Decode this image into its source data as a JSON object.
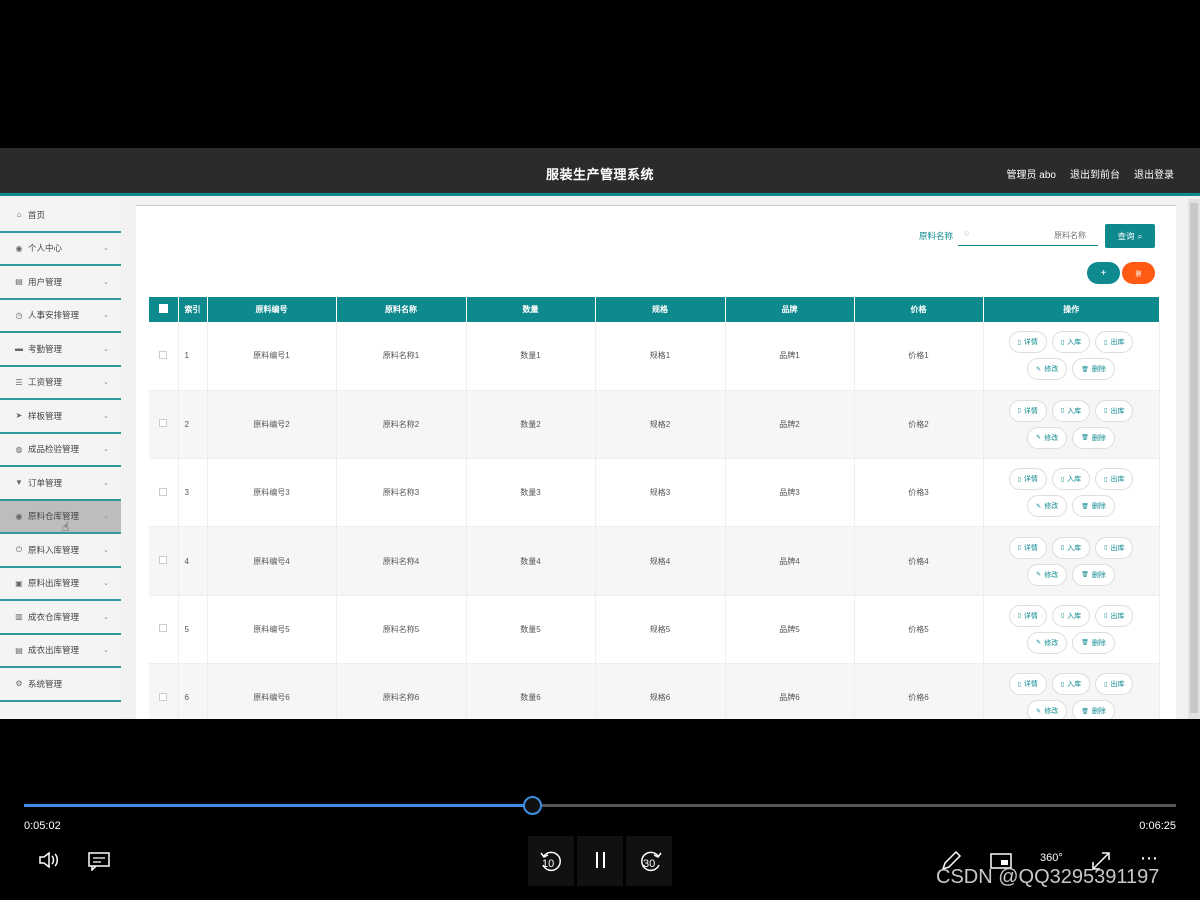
{
  "header": {
    "title": "服装生产管理系统",
    "links": [
      "管理员 abo",
      "退出到前台",
      "退出登录"
    ]
  },
  "sidebar": {
    "items": [
      {
        "label": "首页",
        "icon": "home-icon",
        "glyph": "⌂",
        "chevron": false
      },
      {
        "label": "个人中心",
        "icon": "user-icon",
        "glyph": "◉",
        "chevron": true
      },
      {
        "label": "用户管理",
        "icon": "users-icon",
        "glyph": "▤",
        "chevron": true
      },
      {
        "label": "人事安排管理",
        "icon": "clock-icon",
        "glyph": "◷",
        "chevron": true
      },
      {
        "label": "考勤管理",
        "icon": "chat-icon",
        "glyph": "▬",
        "chevron": true
      },
      {
        "label": "工资管理",
        "icon": "list-icon",
        "glyph": "☰",
        "chevron": true
      },
      {
        "label": "样板管理",
        "icon": "send-icon",
        "glyph": "➤",
        "chevron": true
      },
      {
        "label": "成品检验管理",
        "icon": "globe-icon",
        "glyph": "◍",
        "chevron": true
      },
      {
        "label": "订单管理",
        "icon": "order-icon",
        "glyph": "▼",
        "chevron": true
      },
      {
        "label": "原料仓库管理",
        "icon": "person-icon",
        "glyph": "◉",
        "chevron": true,
        "active": true
      },
      {
        "label": "原料入库管理",
        "icon": "power-icon",
        "glyph": "⏻",
        "chevron": true
      },
      {
        "label": "原料出库管理",
        "icon": "clipboard-icon",
        "glyph": "▣",
        "chevron": true
      },
      {
        "label": "成衣仓库管理",
        "icon": "bar-chart-icon",
        "glyph": "▥",
        "chevron": true
      },
      {
        "label": "成衣出库管理",
        "icon": "doc-icon",
        "glyph": "▤",
        "chevron": true
      },
      {
        "label": "系统管理",
        "icon": "settings-icon",
        "glyph": "⚙",
        "chevron": false
      }
    ]
  },
  "search": {
    "label": "原料名称",
    "placeholder": "原料名称",
    "button": "查询"
  },
  "actions": {
    "add": "+",
    "delete": "删"
  },
  "table": {
    "headers": [
      "索引",
      "原料编号",
      "原料名称",
      "数量",
      "规格",
      "品牌",
      "价格",
      "操作"
    ],
    "rows": [
      {
        "index": "1",
        "code": "原料编号1",
        "name": "原料名称1",
        "qty": "数量1",
        "spec": "规格1",
        "brand": "品牌1",
        "price": "价格1"
      },
      {
        "index": "2",
        "code": "原料编号2",
        "name": "原料名称2",
        "qty": "数量2",
        "spec": "规格2",
        "brand": "品牌2",
        "price": "价格2"
      },
      {
        "index": "3",
        "code": "原料编号3",
        "name": "原料名称3",
        "qty": "数量3",
        "spec": "规格3",
        "brand": "品牌3",
        "price": "价格3"
      },
      {
        "index": "4",
        "code": "原料编号4",
        "name": "原料名称4",
        "qty": "数量4",
        "spec": "规格4",
        "brand": "品牌4",
        "price": "价格4"
      },
      {
        "index": "5",
        "code": "原料编号5",
        "name": "原料名称5",
        "qty": "数量5",
        "spec": "规格5",
        "brand": "品牌5",
        "price": "价格5"
      },
      {
        "index": "6",
        "code": "原料编号6",
        "name": "原料名称6",
        "qty": "数量6",
        "spec": "规格6",
        "brand": "品牌6",
        "price": "价格6"
      }
    ],
    "row_actions": [
      "详情",
      "入库",
      "出库",
      "修改",
      "删除"
    ]
  },
  "player": {
    "current_time": "0:05:02",
    "total_time": "0:06:25",
    "progress": 0.44,
    "skip_back": "10",
    "skip_forward": "30"
  },
  "watermark": "CSDN @QQ3295391197",
  "colors": {
    "accent": "#0e8a8f",
    "danger": "#ff5a14",
    "progress": "#3d8fe0"
  }
}
